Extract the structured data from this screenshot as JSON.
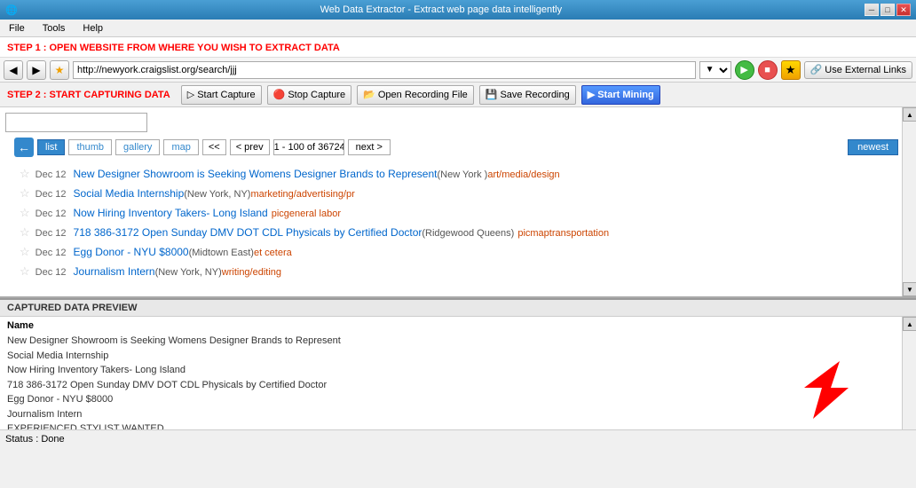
{
  "titleBar": {
    "title": "Web Data Extractor - Extract web page data intelligently",
    "minBtn": "─",
    "maxBtn": "□",
    "closeBtn": "✕"
  },
  "menuBar": {
    "items": [
      "File",
      "Tools",
      "Help"
    ]
  },
  "step1": {
    "label": "STEP 1 : OPEN WEBSITE FROM WHERE YOU WISH TO EXTRACT DATA"
  },
  "navBar": {
    "url": "http://newyork.craigslist.org/search/jjj",
    "extLinksLabel": "Use External Links"
  },
  "step2": {
    "label": "STEP 2 : START CAPTURING DATA",
    "startCapture": "Start Capture",
    "stopCapture": "Stop Capture",
    "openRecording": "Open Recording File",
    "saveRecording": "Save Recording",
    "startMining": "Start Mining"
  },
  "browser": {
    "viewButtons": [
      "list",
      "thumb",
      "gallery",
      "map"
    ],
    "pageFirst": "<<",
    "pagePrev": "< prev",
    "pageInfo": "1 - 100 of 36724",
    "pageNext": "next >",
    "newestBtn": "newest",
    "listings": [
      {
        "date": "Dec 12",
        "title": "New Designer Showroom is Seeking Womens Designer Brands to Represent",
        "location": "(New York )",
        "tag": "art/media/design",
        "extras": ""
      },
      {
        "date": "Dec 12",
        "title": "Social Media Internship",
        "location": "(New York, NY)",
        "tag": "marketing/advertising/pr",
        "extras": ""
      },
      {
        "date": "Dec 12",
        "title": "Now Hiring Inventory Takers- Long Island",
        "location": "",
        "tag": "general labor",
        "extras": "pic"
      },
      {
        "date": "Dec 12",
        "title": "718 386-3172 Open Sunday DMV DOT CDL Physicals by Certified Doctor",
        "location": "(Ridgewood Queens)",
        "tag": "transportation",
        "extras": "pic map"
      },
      {
        "date": "Dec 12",
        "title": "Egg Donor - NYU $8000",
        "location": "(Midtown East)",
        "tag": "et cetera",
        "extras": ""
      },
      {
        "date": "Dec 12",
        "title": "Journalism Intern",
        "location": "(New York, NY)",
        "tag": "writing/editing",
        "extras": ""
      }
    ]
  },
  "capturedData": {
    "header": "CAPTURED DATA PREVIEW",
    "columnHeader": "Name",
    "rows": [
      "New Designer Showroom is Seeking Womens Designer Brands to Represent",
      "Social Media Internship",
      "Now Hiring Inventory Takers- Long Island",
      "718 386-3172 Open Sunday DMV DOT CDL Physicals by Certified Doctor",
      "Egg Donor - NYU $8000",
      "Journalism Intern",
      "EXPERIENCED STYLIST WANTED"
    ]
  },
  "statusBar": {
    "text": "Status :  Done"
  }
}
